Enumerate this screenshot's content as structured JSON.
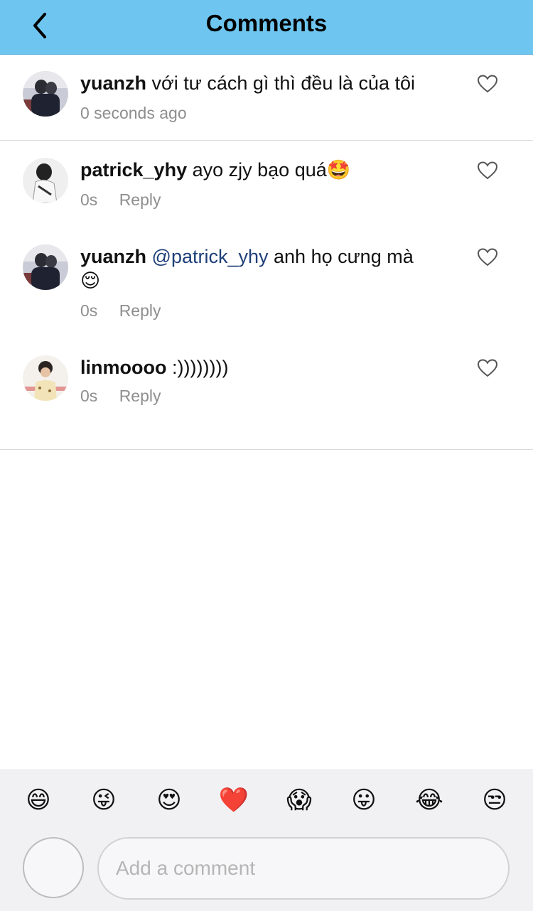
{
  "header": {
    "title": "Comments",
    "back_icon": "chevron-left-icon",
    "background": "#6ec6f0"
  },
  "comments": [
    {
      "username": "yuanzh",
      "text": "với tư cách gì thì đều là của tôi",
      "time": "0 seconds ago"
    },
    {
      "username": "patrick_yhy",
      "text": "ayo zjy bạo quá",
      "emoji": "🤩",
      "time": "0s",
      "reply_label": "Reply"
    },
    {
      "username": "yuanzh",
      "mention": "@patrick_yhy",
      "text": "anh họ cưng mà",
      "emoji": "😌",
      "time": "0s",
      "reply_label": "Reply"
    },
    {
      "username": "linmoooo",
      "text": ":))))))))",
      "time": "0s",
      "reply_label": "Reply"
    }
  ],
  "quick_emojis": [
    "😄",
    "😜",
    "😍",
    "❤️",
    "😱",
    "😛",
    "😂",
    "😒"
  ],
  "composer": {
    "placeholder": "Add a comment"
  },
  "colors": {
    "mention": "#1f3f79",
    "meta": "#8e8e8e",
    "divider": "#dbdbdb"
  }
}
